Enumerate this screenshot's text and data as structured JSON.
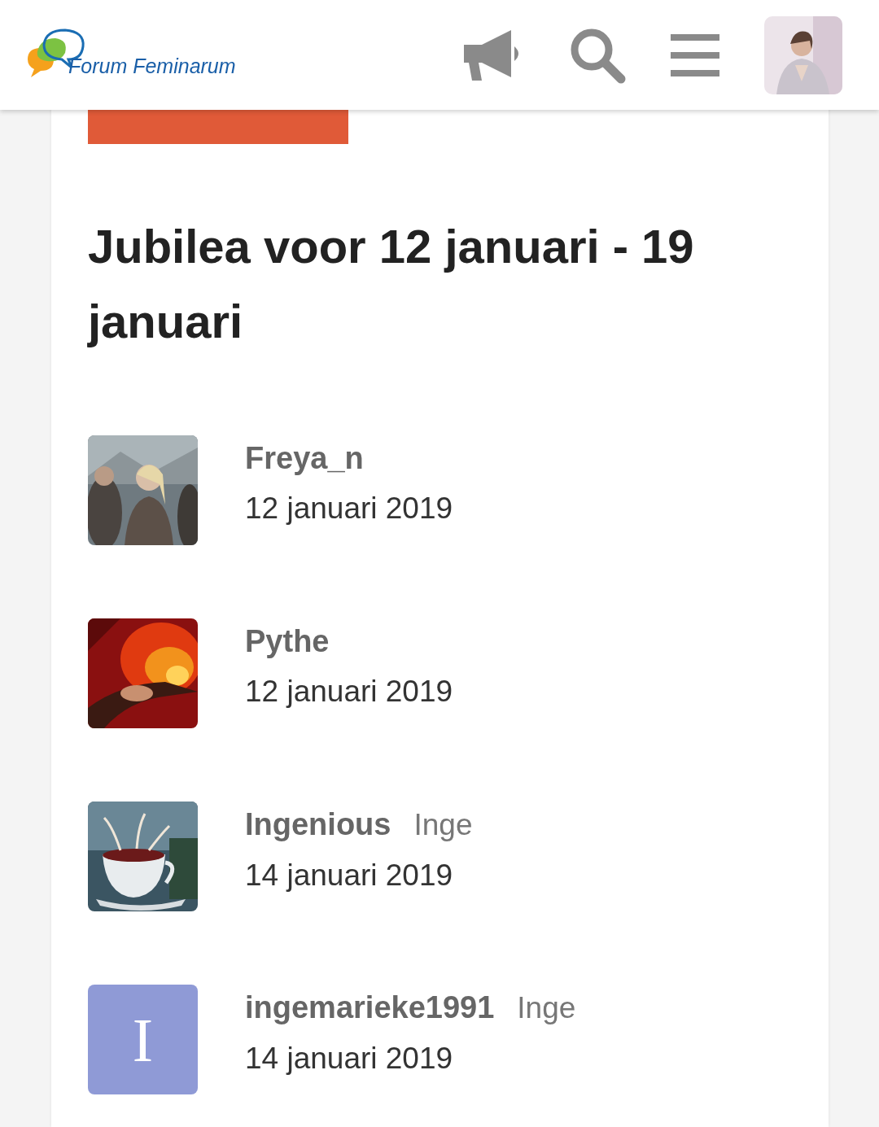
{
  "header": {
    "logo_text": "Forum Feminarum"
  },
  "tabs": [
    {
      "selected": true
    }
  ],
  "heading": "Jubilea voor 12 januari - 19 januari",
  "members": [
    {
      "name": "Freya_n",
      "date": "12 januari 2019"
    },
    {
      "name": "Pythe",
      "date": "12 januari 2019"
    },
    {
      "name": "Ingenious",
      "display_name": "Inge",
      "date": "14 januari 2019"
    },
    {
      "name": "ingemarieke1991",
      "display_name": "Inge",
      "date": "14 januari 2019",
      "avatar": {
        "kind": "letter",
        "letter": "I",
        "color": "#8f9ad6"
      }
    }
  ]
}
